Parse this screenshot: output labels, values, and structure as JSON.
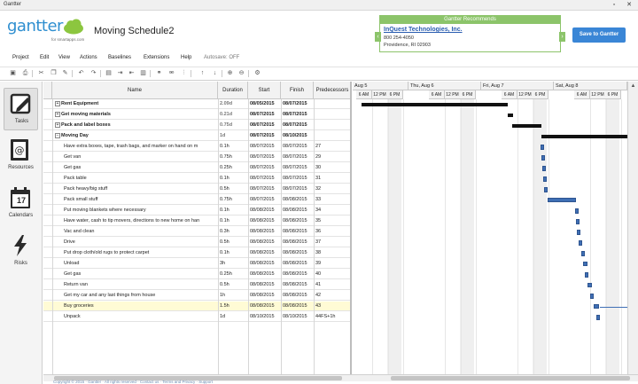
{
  "window": {
    "title": "Gantter"
  },
  "header": {
    "logo_text": "gantter",
    "logo_sub": "for smartapps.com",
    "project_title": "Moving Schedule2",
    "save_label": "Save to Gantter"
  },
  "ad": {
    "heading": "Gantter Recommends",
    "company": "InQuest Technologies, Inc.",
    "phone": "800 254-4050",
    "city": "Providence, RI 02903"
  },
  "menu": {
    "items": [
      "Project",
      "Edit",
      "View",
      "Actions",
      "Baselines",
      "Extensions",
      "Help"
    ],
    "autosave": "Autosave: OFF"
  },
  "sidebar": {
    "items": [
      {
        "label": "Tasks",
        "icon": "tasks-icon"
      },
      {
        "label": "Resources",
        "icon": "resources-icon"
      },
      {
        "label": "Calendars",
        "icon": "calendar-icon",
        "day": "17"
      },
      {
        "label": "Risks",
        "icon": "lightning-icon"
      }
    ]
  },
  "grid": {
    "columns": [
      "Name",
      "Duration",
      "Start",
      "Finish",
      "Predecessors"
    ],
    "rows": [
      {
        "name": "Rent Equipment",
        "duration": "2.09d",
        "start": "08/05/2015",
        "finish": "08/07/2015",
        "pred": "",
        "summary": true,
        "expander": "+"
      },
      {
        "name": "Get moving materials",
        "duration": "0.21d",
        "start": "08/07/2015",
        "finish": "08/07/2015",
        "pred": "",
        "summary": true,
        "expander": "+"
      },
      {
        "name": "Pack and label boxes",
        "duration": "0.75d",
        "start": "08/07/2015",
        "finish": "08/07/2015",
        "pred": "",
        "summary": true,
        "expander": "+"
      },
      {
        "name": "Moving Day",
        "duration": "1d",
        "start": "08/07/2015",
        "finish": "08/10/2015",
        "pred": "",
        "summary": true,
        "expander": "−"
      },
      {
        "name": "Have extra boxes, tape, trash bags, and marker on hand on m",
        "duration": "0.1h",
        "start": "08/07/2015",
        "finish": "08/07/2015",
        "pred": "27"
      },
      {
        "name": "Get van",
        "duration": "0.75h",
        "start": "08/07/2015",
        "finish": "08/07/2015",
        "pred": "29"
      },
      {
        "name": "Get gas",
        "duration": "0.25h",
        "start": "08/07/2015",
        "finish": "08/07/2015",
        "pred": "30"
      },
      {
        "name": "Pack table",
        "duration": "0.1h",
        "start": "08/07/2015",
        "finish": "08/07/2015",
        "pred": "31"
      },
      {
        "name": "Pack heavy/big stuff",
        "duration": "0.5h",
        "start": "08/07/2015",
        "finish": "08/07/2015",
        "pred": "32"
      },
      {
        "name": "Pack small stuff",
        "duration": "0.75h",
        "start": "08/07/2015",
        "finish": "08/08/2015",
        "pred": "33"
      },
      {
        "name": "Put moving blankets where necessary",
        "duration": "0.1h",
        "start": "08/08/2015",
        "finish": "08/08/2015",
        "pred": "34"
      },
      {
        "name": "Have water, cash to tip movers, directions to new home on han",
        "duration": "0.1h",
        "start": "08/08/2015",
        "finish": "08/08/2015",
        "pred": "35"
      },
      {
        "name": "Vac and clean",
        "duration": "0.3h",
        "start": "08/08/2015",
        "finish": "08/08/2015",
        "pred": "36"
      },
      {
        "name": "Drive",
        "duration": "0.5h",
        "start": "08/08/2015",
        "finish": "08/08/2015",
        "pred": "37"
      },
      {
        "name": "Put drop cloth/old rugs to protect carpet",
        "duration": "0.1h",
        "start": "08/08/2015",
        "finish": "08/08/2015",
        "pred": "38"
      },
      {
        "name": "Unload",
        "duration": "3h",
        "start": "08/08/2015",
        "finish": "08/08/2015",
        "pred": "39"
      },
      {
        "name": "Get gas",
        "duration": "0.25h",
        "start": "08/08/2015",
        "finish": "08/08/2015",
        "pred": "40"
      },
      {
        "name": "Return van",
        "duration": "0.5h",
        "start": "08/08/2015",
        "finish": "08/08/2015",
        "pred": "41"
      },
      {
        "name": "Get my car and any last things from house",
        "duration": "1h",
        "start": "08/08/2015",
        "finish": "08/08/2015",
        "pred": "42"
      },
      {
        "name": "Buy groceries",
        "duration": "1.5h",
        "start": "08/08/2015",
        "finish": "08/08/2015",
        "pred": "43",
        "highlight": true
      },
      {
        "name": "Unpack",
        "duration": "1d",
        "start": "08/10/2015",
        "finish": "08/10/2015",
        "pred": "44FS+1h"
      }
    ]
  },
  "chart": {
    "days": [
      "Aug 5",
      "Thu, Aug 6",
      "Fri, Aug 7",
      "Sat, Aug 8"
    ],
    "hours": [
      "6 AM",
      "12 PM",
      "6 PM",
      "6 AM",
      "12 PM",
      "6 PM",
      "6 AM",
      "12 PM",
      "6 PM",
      "6 AM",
      "12 PM",
      "6 PM"
    ]
  },
  "footer": {
    "text": "Copyright © 2015 · Gantter · All rights reserved · Contact us · Terms and Privacy · Support"
  }
}
